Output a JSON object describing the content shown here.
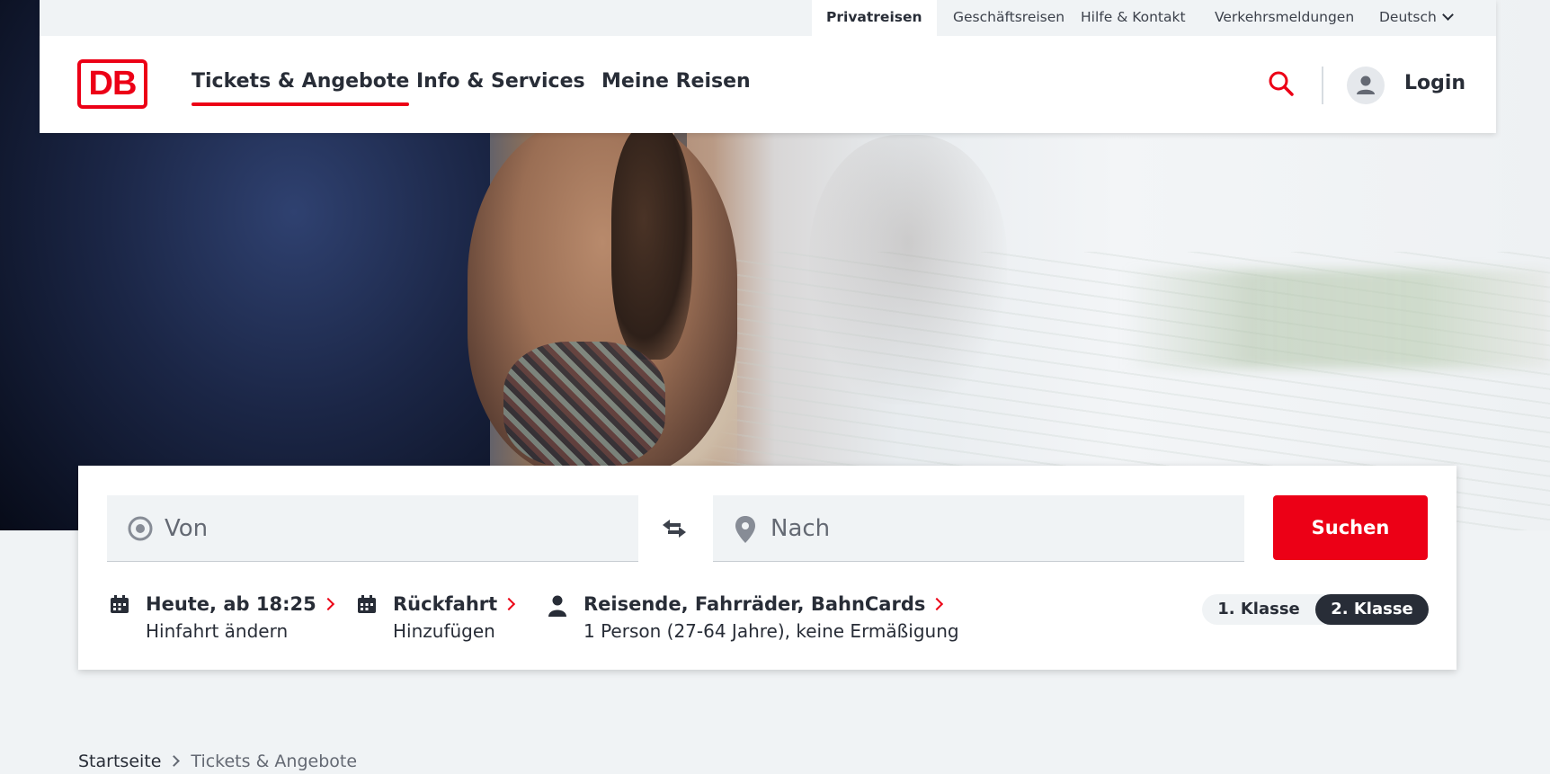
{
  "meta_nav": {
    "items": [
      "Privatreisen",
      "Geschäftsreisen",
      "Hilfe & Kontakt",
      "Verkehrsmeldungen"
    ],
    "language": "Deutsch",
    "active": "Privatreisen"
  },
  "header": {
    "logo_text": "DB",
    "nav": [
      "Tickets & Angebote",
      "Info & Services",
      "Meine Reisen"
    ],
    "active_nav": "Tickets & Angebote",
    "login_label": "Login",
    "icons": [
      "search-icon",
      "user-icon"
    ]
  },
  "search": {
    "from_placeholder": "Von",
    "to_placeholder": "Nach",
    "submit_label": "Suchen",
    "outbound": {
      "title": "Heute, ab 18:25",
      "subtitle": "Hinfahrt ändern"
    },
    "return": {
      "title": "Rückfahrt",
      "subtitle": "Hinzufügen"
    },
    "travellers": {
      "title": "Reisende, Fahrräder, BahnCards",
      "subtitle": "1 Person (27-64 Jahre), keine Ermäßigung"
    },
    "classes": [
      "1. Klasse",
      "2. Klasse"
    ],
    "selected_class": "2. Klasse"
  },
  "breadcrumb": [
    "Startseite",
    "Tickets & Angebote"
  ],
  "colors": {
    "brand_red": "#ec0016",
    "dark": "#282d37",
    "background": "#f0f3f5"
  }
}
